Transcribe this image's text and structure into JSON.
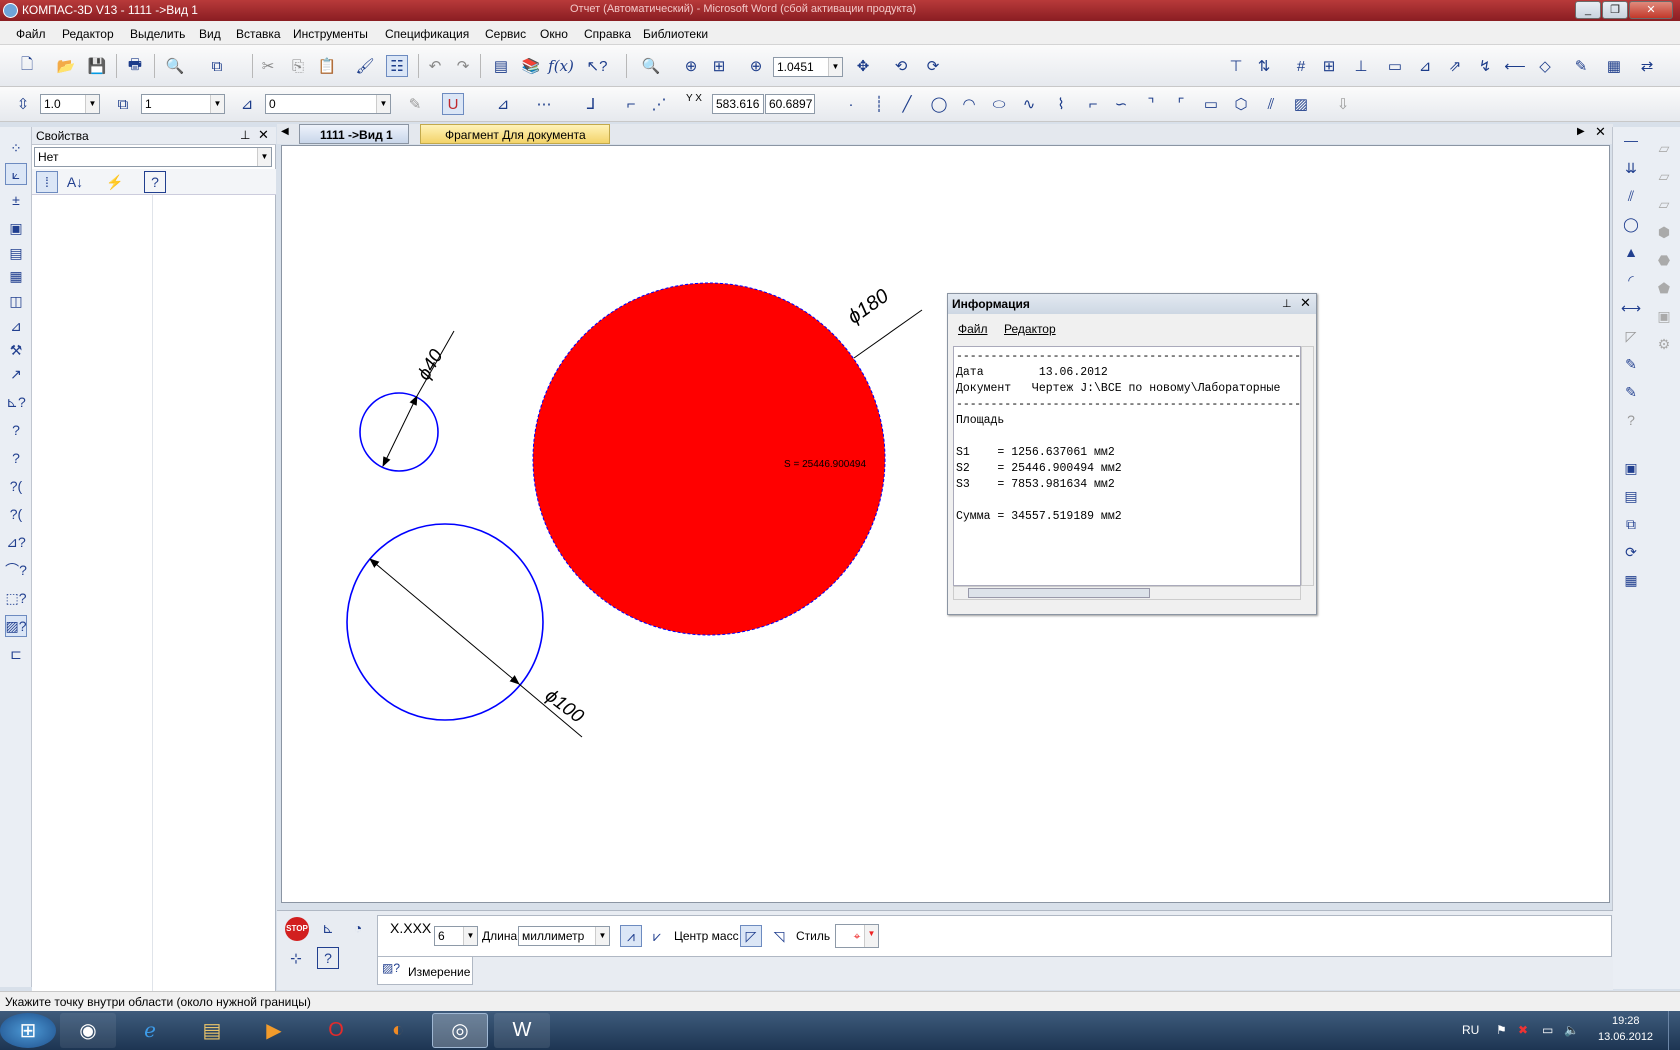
{
  "window": {
    "title": "КОМПАС-3D V13 - 1111 ->Вид 1",
    "title_right": "Отчет (Автоматический) - Microsoft Word (сбой активации продукта)"
  },
  "menu": [
    "Файл",
    "Редактор",
    "Выделить",
    "Вид",
    "Вставка",
    "Инструменты",
    "Спецификация",
    "Сервис",
    "Окно",
    "Справка",
    "Библиотеки"
  ],
  "toolbar1": {
    "zoom_value": "1.0451"
  },
  "toolbar2": {
    "step_value": "1.0",
    "layer_value": "1",
    "style_value": "0",
    "coord_x": "583.616",
    "coord_y": "60.6897"
  },
  "props_panel": {
    "title": "Свойства",
    "selection": "Нет"
  },
  "tabs": [
    {
      "label": "1111 ->Вид 1",
      "active": true
    },
    {
      "label": "Фрагмент Для документа",
      "active": false
    }
  ],
  "drawing": {
    "dim_small": "ϕ40",
    "dim_large": "ϕ180",
    "dim_medium": "ϕ100",
    "area_label": "S = 25446.900494",
    "fill_color": "#ff0000",
    "outline_color": "#0000ff"
  },
  "info_window": {
    "title": "Информация",
    "menu": [
      "Файл",
      "Редактор"
    ],
    "lines": [
      "--------------------------------------------------",
      "Дата        13.06.2012",
      "Документ   Чертеж J:\\ВСЕ по новому\\Лабораторные",
      "--------------------------------------------------",
      "Площадь",
      "",
      "S1    = 1256.637061 мм2",
      "S2    = 25446.900494 мм2",
      "S3    = 7853.981634 мм2",
      "",
      "Сумма = 34557.519189 мм2"
    ]
  },
  "bottom_panel": {
    "precision_label": "X.XXX",
    "precision_value": "6",
    "length_label": "Длина",
    "length_unit": "миллиметр",
    "center_mass_label": "Центр масс",
    "style_label": "Стиль",
    "measure_tab": "Измерение",
    "stop_label": "STOP"
  },
  "status_text": "Укажите точку внутри области (около нужной границы)",
  "tray": {
    "lang": "RU",
    "time": "19:28",
    "date": "13.06.2012"
  }
}
